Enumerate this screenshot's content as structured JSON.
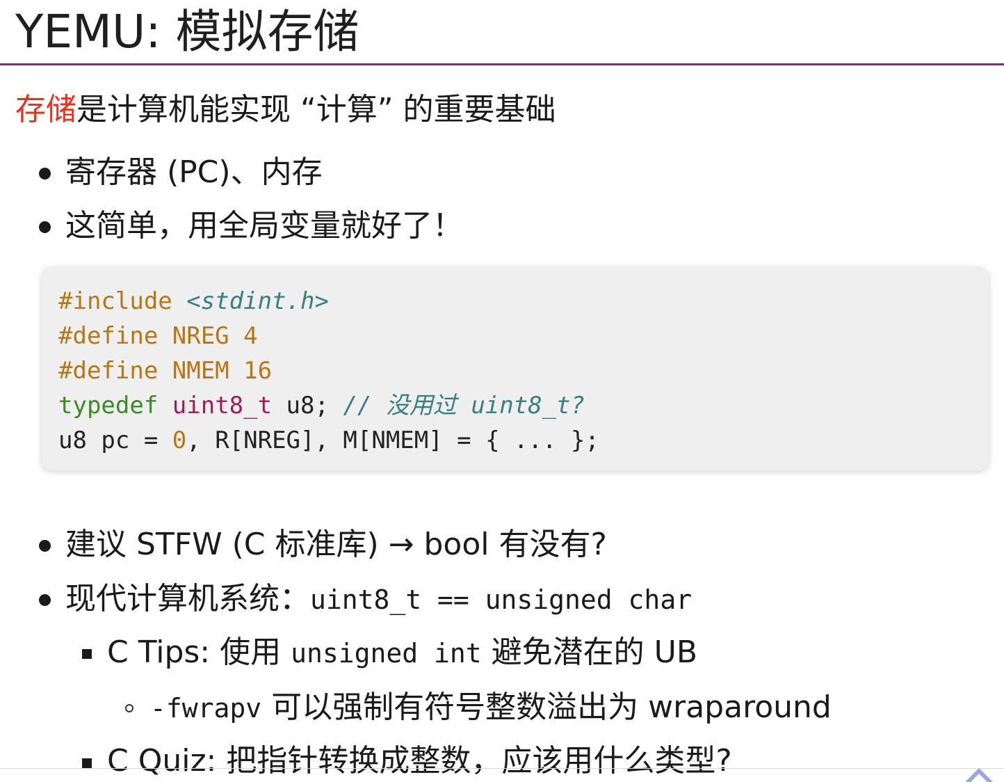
{
  "slide": {
    "title": "YEMU: 模拟存储",
    "intro": {
      "highlight": "存储",
      "rest": "是计算机能实现 “计算” 的重要基础"
    },
    "bullets_top": [
      "寄存器 (PC)、内存",
      "这简单，用全局变量就好了！"
    ],
    "code": {
      "line1": {
        "directive": "#include",
        "header": "<stdint.h>"
      },
      "line2": {
        "text": "#define NREG 4"
      },
      "line3": {
        "text": "#define NMEM 16"
      },
      "line4": {
        "kw": "typedef",
        "type": "uint8_t",
        "rest": " u8; ",
        "comment": "// 没用过 uint8_t?"
      },
      "line5": {
        "a": "u8 pc = ",
        "zero": "0",
        "b": ", R[NREG], M[NMEM] = { ... };"
      }
    },
    "bullet3": {
      "text": "建议 STFW (C 标准库) → bool 有没有?"
    },
    "bullet4": {
      "text": "现代计算机系统：",
      "code": "uint8_t == unsigned char"
    },
    "sub1": {
      "a": "C Tips: 使用",
      "code": "unsigned int",
      "b": "避免潜在的 UB"
    },
    "subsub1": {
      "code": "-fwrapv",
      "text": "可以强制有符号整数溢出为 wraparound"
    },
    "sub2": {
      "text": "C Quiz: 把指针转换成整数，应该用什么类型?"
    },
    "icons": {
      "nav": "chevron-up-icon"
    }
  }
}
